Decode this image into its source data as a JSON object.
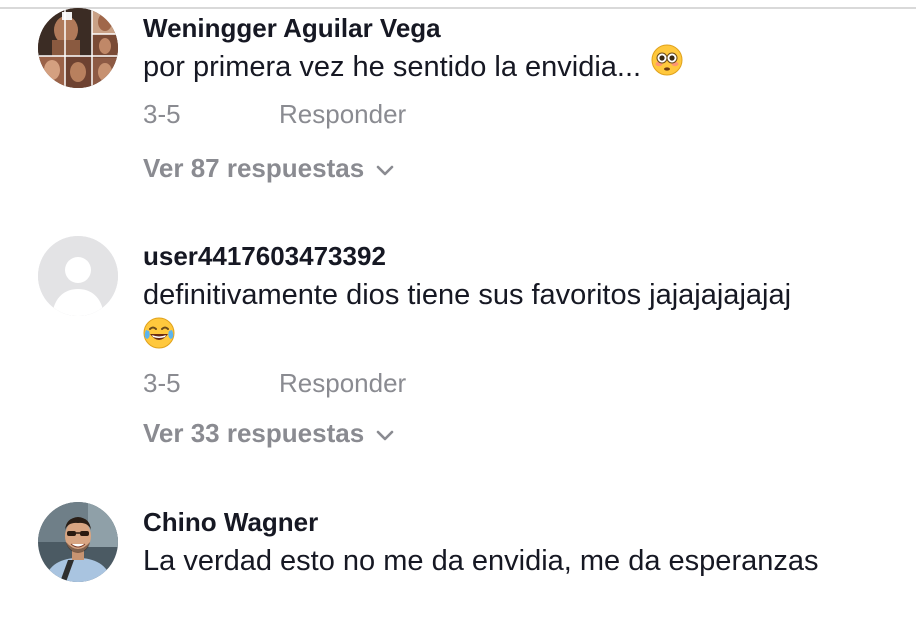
{
  "comments": [
    {
      "username": "Weningger Aguilar Vega",
      "text": "por primera vez he sentido la envidia...",
      "emoji": "flushed-face",
      "date": "3-5",
      "reply_label": "Responder",
      "view_replies": "Ver 87 respuestas"
    },
    {
      "username": "user4417603473392",
      "text": "definitivamente dios tiene sus favoritos jajajajajajaj",
      "emoji": "tears-of-joy-face",
      "date": "3-5",
      "reply_label": "Responder",
      "view_replies": "Ver 33 respuestas"
    },
    {
      "username": "Chino Wagner",
      "text": "La verdad esto no me da envidia, me da esperanzas"
    }
  ],
  "colors": {
    "text_primary": "#161823",
    "text_secondary": "#8a8b91",
    "divider": "#d9d9d9",
    "default_avatar_bg": "#e3e3e5"
  }
}
